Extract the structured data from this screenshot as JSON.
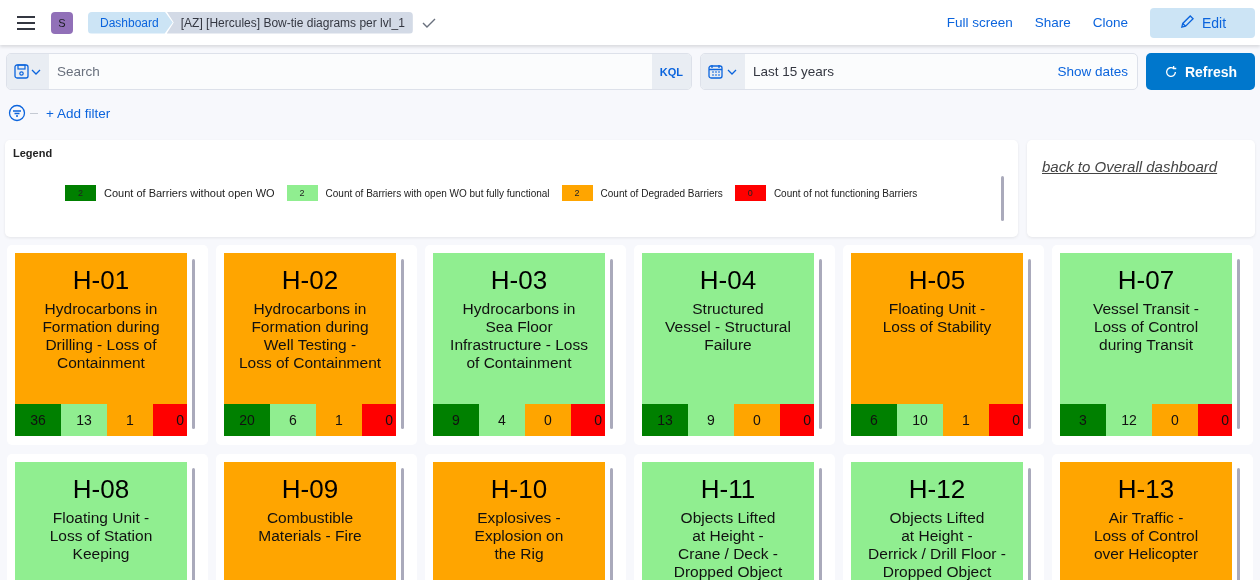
{
  "header": {
    "avatar": "S",
    "breadcrumbs": [
      {
        "label": "Dashboard",
        "selected": false
      },
      {
        "label": "[AZ] [Hercules] Bow-tie diagrams per lvl_1",
        "selected": true
      }
    ],
    "actions": [
      "Full screen",
      "Share",
      "Clone"
    ],
    "edit_button": "Edit"
  },
  "query_bar": {
    "placeholder": "Search",
    "language": "KQL",
    "time_range": "Last 15 years",
    "show_dates": "Show dates",
    "refresh": "Refresh"
  },
  "filter_bar": {
    "add_filter": "+ Add filter"
  },
  "legend": {
    "title": "Legend",
    "items": [
      {
        "count": "2",
        "label": "Count of Barriers without open WO",
        "color": "#008000"
      },
      {
        "count": "2",
        "label": "Count of Barriers with open WO but fully functional",
        "color": "#90ee90"
      },
      {
        "count": "2",
        "label": "Count of Degraded Barriers",
        "color": "#ffa500"
      },
      {
        "count": "0",
        "label": "Count of not functioning Barriers",
        "color": "#ff0000"
      }
    ]
  },
  "back_link": "back to Overall dashboard",
  "tiles": [
    {
      "code": "H-01",
      "lines": [
        "Hydrocarbons in",
        "Formation during",
        "Drilling - Loss of",
        "Containment"
      ],
      "color": "#ffa500",
      "counts": [
        "36",
        "13",
        "1",
        "0"
      ]
    },
    {
      "code": "H-02",
      "lines": [
        "Hydrocarbons in",
        "Formation during",
        "Well Testing -",
        "Loss of Containment"
      ],
      "color": "#ffa500",
      "counts": [
        "20",
        "6",
        "1",
        "0"
      ]
    },
    {
      "code": "H-03",
      "lines": [
        "Hydrocarbons in",
        "Sea Floor",
        "Infrastructure - Loss",
        "of Containment"
      ],
      "color": "#90ee90",
      "counts": [
        "9",
        "4",
        "0",
        "0"
      ]
    },
    {
      "code": "H-04",
      "lines": [
        "Structured",
        "Vessel - Structural",
        "Failure"
      ],
      "color": "#90ee90",
      "counts": [
        "13",
        "9",
        "0",
        "0"
      ]
    },
    {
      "code": "H-05",
      "lines": [
        "Floating Unit -",
        "Loss of Stability"
      ],
      "color": "#ffa500",
      "counts": [
        "6",
        "10",
        "1",
        "0"
      ]
    },
    {
      "code": "H-07",
      "lines": [
        "Vessel Transit -",
        "Loss of Control",
        "during Transit"
      ],
      "color": "#90ee90",
      "counts": [
        "3",
        "12",
        "0",
        "0"
      ]
    },
    {
      "code": "H-08",
      "lines": [
        "Floating Unit -",
        "Loss of Station",
        "Keeping"
      ],
      "color": "#90ee90"
    },
    {
      "code": "H-09",
      "lines": [
        "Combustible",
        "Materials - Fire"
      ],
      "color": "#ffa500"
    },
    {
      "code": "H-10",
      "lines": [
        "Explosives -",
        "Explosion on",
        "the Rig"
      ],
      "color": "#ffa500"
    },
    {
      "code": "H-11",
      "lines": [
        "Objects Lifted",
        "at Height -",
        "Crane / Deck -",
        "Dropped Object"
      ],
      "color": "#90ee90"
    },
    {
      "code": "H-12",
      "lines": [
        "Objects Lifted",
        "at Height -",
        "Derrick / Drill Floor -",
        "Dropped Object"
      ],
      "color": "#90ee90"
    },
    {
      "code": "H-13",
      "lines": [
        "Air Traffic -",
        "Loss of Control",
        "over Helicopter"
      ],
      "color": "#ffa500"
    }
  ]
}
